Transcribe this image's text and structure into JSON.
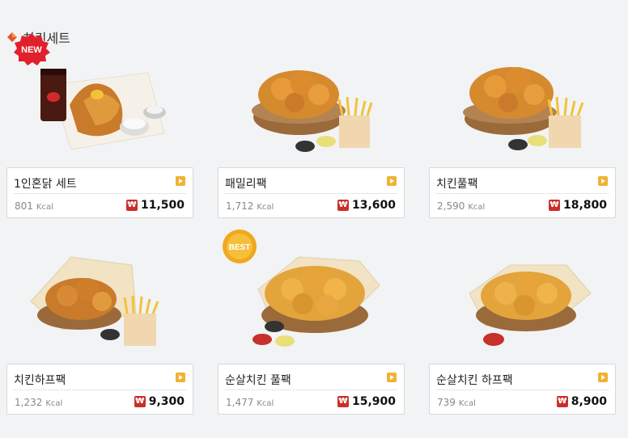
{
  "section": {
    "title": "치킨세트",
    "icon": "diamond-icon"
  },
  "currency_symbol": "₩",
  "kcal_unit": "Kcal",
  "colors": {
    "accent": "#c8302a",
    "arrow": "#f1b230"
  },
  "badges": {
    "new": "NEW",
    "best": "BEST"
  },
  "products": [
    {
      "name": "1인혼닭 세트",
      "kcal": "801",
      "price": "11,500",
      "badge": "NEW"
    },
    {
      "name": "패밀리팩",
      "kcal": "1,712",
      "price": "13,600",
      "badge": ""
    },
    {
      "name": "치킨풀팩",
      "kcal": "2,590",
      "price": "18,800",
      "badge": ""
    },
    {
      "name": "치킨하프팩",
      "kcal": "1,232",
      "price": "9,300",
      "badge": ""
    },
    {
      "name": "순살치킨 풀팩",
      "kcal": "1,477",
      "price": "15,900",
      "badge": "BEST"
    },
    {
      "name": "순살치킨 하프팩",
      "kcal": "739",
      "price": "8,900",
      "badge": ""
    }
  ]
}
